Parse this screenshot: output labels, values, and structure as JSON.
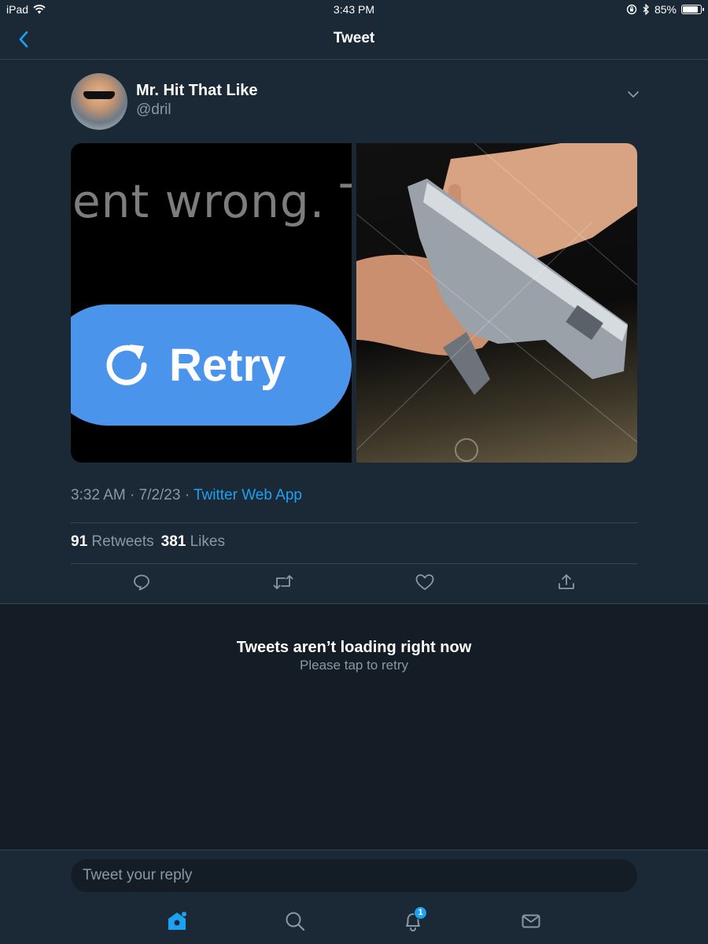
{
  "status_bar": {
    "device": "iPad",
    "time": "3:43 PM",
    "battery_percent": "85%",
    "battery_level": 0.85
  },
  "nav": {
    "title": "Tweet",
    "back_icon": "chevron-left-icon"
  },
  "tweet": {
    "author_name": "Mr. Hit That Like",
    "author_handle": "@dril",
    "media": {
      "left_image": {
        "text": "ent wrong. T",
        "button_label": "Retry"
      },
      "right_image": {
        "description_icon": "photo-icon"
      }
    },
    "timestamp": "3:32 AM · 7/2/23 · ",
    "source": "Twitter Web App",
    "retweet_count": "91",
    "retweet_label": "Retweets",
    "like_count": "381",
    "like_label": "Likes"
  },
  "empty_state": {
    "title": "Tweets aren’t loading right now",
    "subtitle": "Please tap to retry"
  },
  "composer": {
    "placeholder": "Tweet your reply"
  },
  "tabbar": {
    "notifications_badge": "1"
  },
  "colors": {
    "accent": "#1da1f2",
    "background": "#141d26",
    "surface": "#1b2836",
    "secondary_text": "#8899a6",
    "divider": "#38444d"
  }
}
